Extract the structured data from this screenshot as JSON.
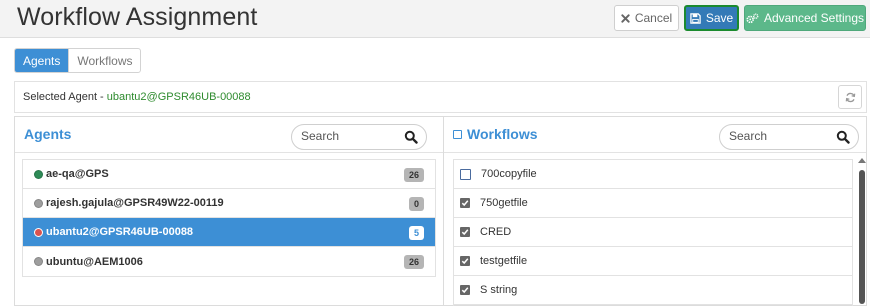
{
  "header": {
    "title": "Workflow Assignment",
    "cancel_label": "Cancel",
    "save_label": "Save",
    "advanced_label": "Advanced Settings"
  },
  "tabs": [
    {
      "label": "Agents",
      "active": true
    },
    {
      "label": "Workflows",
      "active": false
    }
  ],
  "selected_agent": {
    "prefix": "Selected Agent - ",
    "name": "ubantu2@GPSR46UB-00088"
  },
  "agents_panel": {
    "title": "Agents",
    "search_placeholder": "Search",
    "items": [
      {
        "name": "ae-qa@GPS",
        "count": "26",
        "status_color": "#2e8b57",
        "selected": false
      },
      {
        "name": "rajesh.gajula@GPSR49W22-00119",
        "count": "0",
        "status_color": "#9e9e9e",
        "selected": false
      },
      {
        "name": "ubantu2@GPSR46UB-00088",
        "count": "5",
        "status_color": "#d9534f",
        "selected": true
      },
      {
        "name": "ubuntu@AEM1006",
        "count": "26",
        "status_color": "#9e9e9e",
        "selected": false
      }
    ]
  },
  "workflows_panel": {
    "title": "Workflows",
    "title_icon": "checkbox-icon",
    "search_placeholder": "Search",
    "items": [
      {
        "name": "700copyfile",
        "checked": false
      },
      {
        "name": "750getfile",
        "checked": true
      },
      {
        "name": "CRED",
        "checked": true
      },
      {
        "name": "testgetfile",
        "checked": true
      },
      {
        "name": "S string",
        "checked": true
      }
    ]
  },
  "colors": {
    "primary": "#3d8fd5",
    "save": "#337ab7",
    "advanced": "#5cb88a",
    "selected_agent_text": "#2e8b2e"
  }
}
